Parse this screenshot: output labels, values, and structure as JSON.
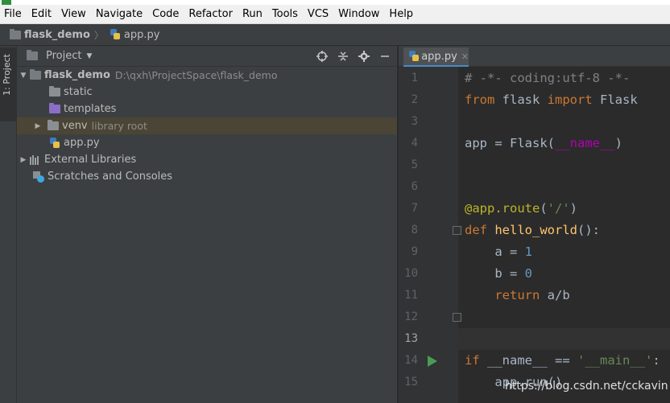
{
  "menu": [
    "File",
    "Edit",
    "View",
    "Navigate",
    "Code",
    "Refactor",
    "Run",
    "Tools",
    "VCS",
    "Window",
    "Help"
  ],
  "navbar": {
    "project": "flask_demo",
    "file": "app.py"
  },
  "toolstrip": {
    "project_tab": "1: Project"
  },
  "project_panel": {
    "title": "Project",
    "tree": {
      "root": {
        "name": "flask_demo",
        "path": "D:\\qxh\\ProjectSpace\\flask_demo"
      },
      "static": "static",
      "templates": "templates",
      "venv": {
        "name": "venv",
        "note": "library root"
      },
      "app": "app.py",
      "external": "External Libraries",
      "scratches": "Scratches and Consoles"
    },
    "icons": [
      "locate-icon",
      "collapse-icon",
      "gear-icon",
      "minimize-icon"
    ]
  },
  "editor": {
    "tab": "app.py",
    "line_numbers": [
      "1",
      "2",
      "3",
      "4",
      "5",
      "6",
      "7",
      "8",
      "9",
      "10",
      "11",
      "12",
      "13",
      "14",
      "15"
    ],
    "current_line": "13",
    "code": {
      "l1": "# -*- coding:utf-8 -*-",
      "l2_kw1": "from",
      "l2_mod": " flask ",
      "l2_kw2": "import",
      "l2_name": " Flask",
      "l4_a": "app = Flask(",
      "l4_b": "__name__",
      "l4_c": ")",
      "l7_dec": "@app.route",
      "l7_p1": "(",
      "l7_str": "'/'",
      "l7_p2": ")",
      "l8_kw": "def",
      "l8_fn": " hello_world",
      "l8_rest": "():",
      "l9_a": "    a = ",
      "l9_n": "1",
      "l10_a": "    b = ",
      "l10_n": "0",
      "l11_kw": "    return",
      "l11_rest": " a/b",
      "l14_kw": "if",
      "l14_a": " __name__ == ",
      "l14_str": "'__main__'",
      "l14_b": ":",
      "l15": "    app.run()"
    }
  },
  "watermark": "https://blog.csdn.net/cckavin",
  "colors": {
    "keyword": "#cc7832",
    "string": "#6a8759",
    "number": "#6897bb",
    "function": "#ffc66d",
    "comment": "#808080",
    "decorator": "#bbb529"
  }
}
